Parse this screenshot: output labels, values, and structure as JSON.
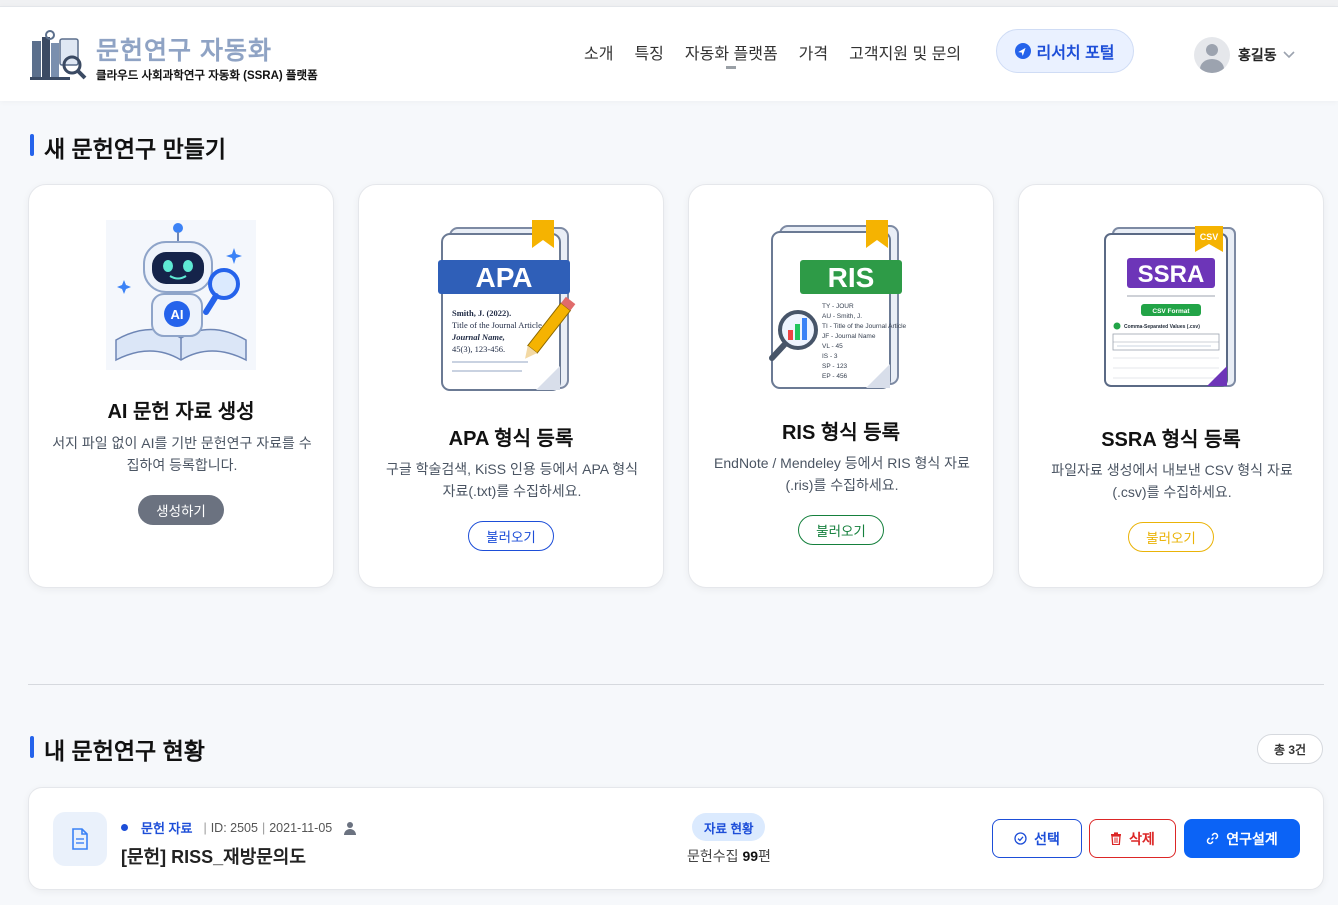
{
  "header": {
    "logo_title": "문헌연구 자동화",
    "logo_subtitle": "클라우드 사회과학연구 자동화 (SSRA) 플랫폼",
    "nav": [
      "소개",
      "특징",
      "자동화 플랫폼",
      "가격",
      "고객지원 및 문의"
    ],
    "active_nav": "자동화 플랫폼",
    "portal_button": "리서치 포털",
    "user_name": "홍길동"
  },
  "new_section": {
    "title": "새 문헌연구 만들기",
    "cards": [
      {
        "title": "AI 문헌 자료 생성",
        "desc": "서지 파일 없이 AI를 기반 문헌연구 자료를 수집하여 등록합니다.",
        "button": "생성하기",
        "color": "#6b7280"
      },
      {
        "title": "APA 형식 등록",
        "desc": "구글 학술검색, KiSS 인용 등에서 APA 형식 자료(.txt)를 수집하세요.",
        "button": "불러오기",
        "color": "#1d4ed8",
        "image_text": {
          "label": "APA",
          "lines": [
            "Smith, J. (2022).",
            "Title of the Journal Article.",
            "Journal Name,",
            "45(3), 123-456."
          ]
        }
      },
      {
        "title": "RIS 형식 등록",
        "desc": "EndNote / Mendeley 등에서 RIS 형식 자료(.ris)를 수집하세요.",
        "button": "불러오기",
        "color": "#15803d",
        "image_text": {
          "label": "RIS",
          "lines": [
            "TY - JOUR",
            "AU - Smith, J.",
            "TI - Title of the Journal Article",
            "JF - Journal Name",
            "VL - 45",
            "IS - 3",
            "SP - 123",
            "EP - 456"
          ]
        }
      },
      {
        "title": "SSRA 형식 등록",
        "desc": "파일자료 생성에서 내보낸 CSV 형식 자료(.csv)를 수집하세요.",
        "button": "불러오기",
        "color": "#eab308",
        "image_text": {
          "label": "SSRA",
          "tag": "CSV",
          "button": "CSV Format",
          "check": "Comma-Separated Values (.csv)"
        }
      }
    ]
  },
  "my_section": {
    "title": "내 문헌연구 현황",
    "total": "총 3건",
    "rows": [
      {
        "type": "문헌 자료",
        "id": "ID: 2505",
        "date": "2021-11-05",
        "title": "[문헌] RISS_재방문의도",
        "status": "자료 현황",
        "count_label": "문헌수집",
        "count": "99",
        "count_unit": "편",
        "buttons": {
          "select": "선택",
          "delete": "삭제",
          "design": "연구설계"
        }
      }
    ]
  },
  "icons": [
    "logo-books-icon",
    "compass-icon",
    "chevron-down-icon",
    "document-icon",
    "person-icon",
    "check-circle-icon",
    "trash-icon",
    "link-icon"
  ]
}
